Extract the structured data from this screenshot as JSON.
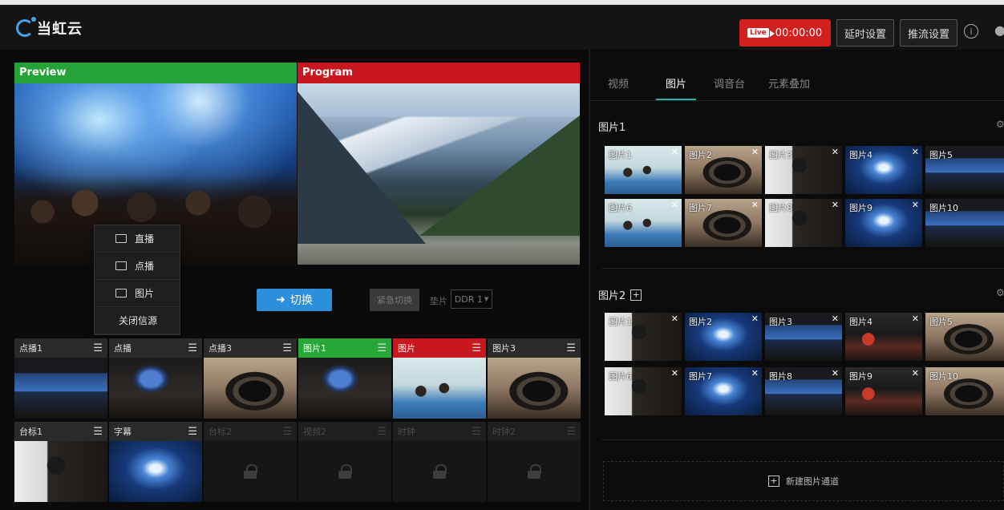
{
  "header": {
    "logo_text": "当虹云",
    "live_badge": "Live",
    "timer": "00:00:00",
    "delay_settings": "延时设置",
    "push_settings": "推流设置",
    "help_icon": "i"
  },
  "monitors": {
    "preview_label": "Preview",
    "program_label": "Program",
    "preview_color": "#23a338",
    "program_color": "#c8171f"
  },
  "context_menu": {
    "items": [
      "直播",
      "点播",
      "图片",
      "关闭信源"
    ]
  },
  "controls": {
    "switch_label": "切换",
    "emergency_label": "紧急切换",
    "slot_label": "垫片",
    "ddr_value": "DDR 1"
  },
  "sources": {
    "row1": [
      "点播1",
      "点播",
      "点播3",
      "图片1",
      "图片",
      "图片3"
    ],
    "row2": [
      "台标1",
      "字幕",
      "台标2",
      "视频2",
      "时钟",
      "时钟2"
    ]
  },
  "right_panel": {
    "tabs": [
      "视频",
      "图片",
      "调音台",
      "元素叠加"
    ],
    "active_tab": "图片",
    "group1": {
      "title": "图片1",
      "items": [
        "图片1",
        "图片2",
        "图片3",
        "图片4",
        "图片5",
        "图片6",
        "图片7",
        "图片8",
        "图片9",
        "图片10"
      ]
    },
    "group2": {
      "title": "图片2",
      "items": [
        "图片1",
        "图片2",
        "图片3",
        "图片4",
        "图片5",
        "图片6",
        "图片7",
        "图片8",
        "图片9",
        "图片10"
      ]
    },
    "new_channel_label": "新建图片通道"
  },
  "colors": {
    "accent_blue": "#2b8fdc",
    "live_red": "#d41f1f",
    "tab_underline": "#26b3a6"
  }
}
